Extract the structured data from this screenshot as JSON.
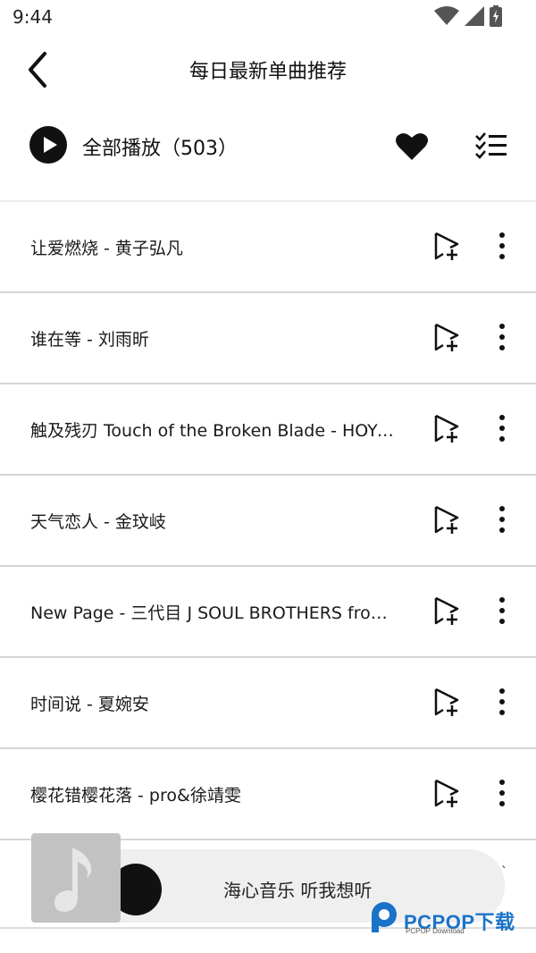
{
  "status": {
    "time": "9:44"
  },
  "header": {
    "title": "每日最新单曲推荐"
  },
  "play_all": {
    "label": "全部播放（503）"
  },
  "songs": [
    {
      "title": "让爱燃烧 - 黄子弘凡"
    },
    {
      "title": "谁在等 - 刘雨昕"
    },
    {
      "title": "触及残刃 Touch of the Broken Blade - HOYO-MiX"
    },
    {
      "title": "天气恋人 - 金玟岐"
    },
    {
      "title": "New Page - 三代目 J SOUL BROTHERS from EXILE TRIBE"
    },
    {
      "title": "时间说 - 夏婉安"
    },
    {
      "title": "樱花错樱花落 - pro&徐靖雯"
    }
  ],
  "mini_player": {
    "text": "海心音乐 听我想听",
    "tick": "`"
  },
  "watermark": {
    "brand": "PCPOP下载",
    "sub": "PCPOP Download"
  },
  "icons": {
    "back": "chevron-left-icon",
    "play": "play-icon",
    "favorite": "heart-icon",
    "multiselect": "checklist-icon",
    "add": "add-to-playlist-icon",
    "more": "more-vertical-icon",
    "note": "music-note-icon"
  },
  "colors": {
    "accent": "#111111",
    "watermark": "#1a73c8"
  }
}
